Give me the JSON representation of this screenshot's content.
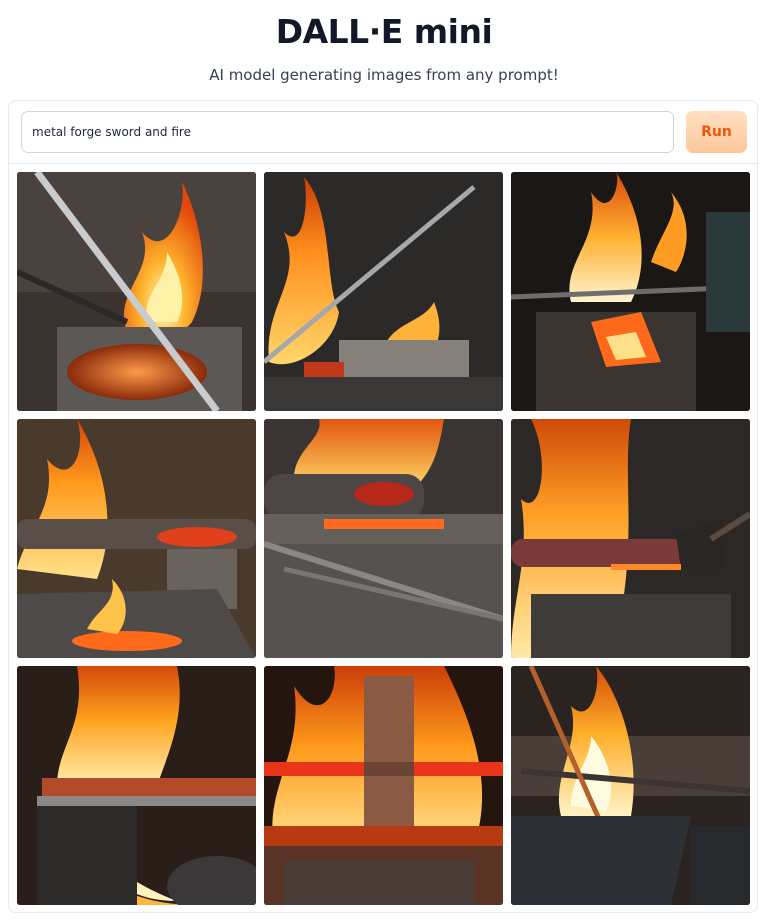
{
  "header": {
    "title": "DALL·E mini",
    "subtitle": "AI model generating images from any prompt!"
  },
  "prompt": {
    "value": "metal forge sword and fire",
    "run_label": "Run"
  },
  "results": [
    {
      "name": "generated-image-1",
      "theme": "sword-on-anvil-with-flames"
    },
    {
      "name": "generated-image-2",
      "theme": "blade-over-anvil-with-flames"
    },
    {
      "name": "generated-image-3",
      "theme": "glowing-forge-with-blade"
    },
    {
      "name": "generated-image-4",
      "theme": "heated-bar-on-anvil"
    },
    {
      "name": "generated-image-5",
      "theme": "metal-bars-on-anvil"
    },
    {
      "name": "generated-image-6",
      "theme": "tongs-holding-hot-bar"
    },
    {
      "name": "generated-image-7",
      "theme": "blade-over-fire"
    },
    {
      "name": "generated-image-8",
      "theme": "blade-in-flames"
    },
    {
      "name": "generated-image-9",
      "theme": "rod-in-forge-fire"
    }
  ]
}
